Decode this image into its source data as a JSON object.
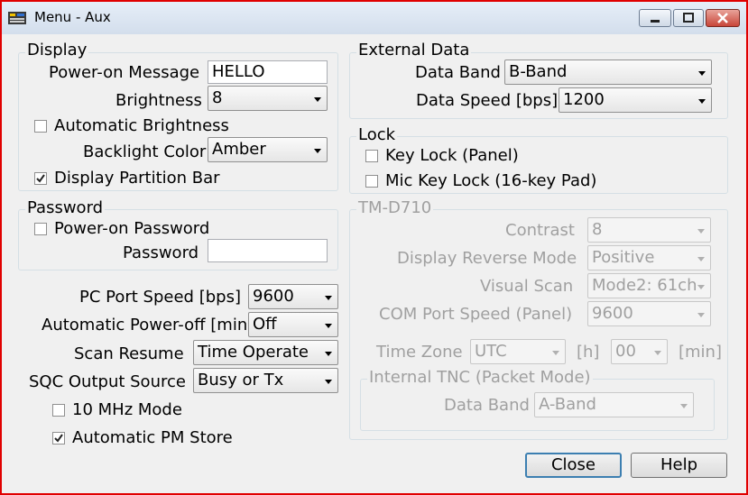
{
  "window": {
    "title": "Menu - Aux"
  },
  "display": {
    "legend": "Display",
    "power_on_message_label": "Power-on Message",
    "power_on_message_value": "HELLO",
    "brightness_label": "Brightness",
    "brightness_value": "8",
    "auto_brightness_label": "Automatic Brightness",
    "auto_brightness_checked": false,
    "backlight_color_label": "Backlight Color",
    "backlight_color_value": "Amber",
    "partition_bar_label": "Display Partition Bar",
    "partition_bar_checked": true
  },
  "password": {
    "legend": "Password",
    "power_on_password_label": "Power-on Password",
    "power_on_password_checked": false,
    "password_label": "Password",
    "password_value": ""
  },
  "misc": {
    "pc_port_speed_label": "PC Port Speed [bps]",
    "pc_port_speed_value": "9600",
    "auto_power_off_label": "Automatic Power-off [min]",
    "auto_power_off_value": "Off",
    "scan_resume_label": "Scan Resume",
    "scan_resume_value": "Time Operate",
    "sqc_output_label": "SQC Output Source",
    "sqc_output_value": "Busy or Tx",
    "mhz10_label": "10 MHz Mode",
    "mhz10_checked": false,
    "auto_pm_label": "Automatic PM Store",
    "auto_pm_checked": true
  },
  "external_data": {
    "legend": "External Data",
    "data_band_label": "Data Band",
    "data_band_value": "B-Band",
    "data_speed_label": "Data Speed [bps]",
    "data_speed_value": "1200"
  },
  "lock": {
    "legend": "Lock",
    "key_lock_label": "Key Lock (Panel)",
    "key_lock_checked": false,
    "mic_key_lock_label": "Mic Key Lock (16-key Pad)",
    "mic_key_lock_checked": false
  },
  "tmd710": {
    "legend": "TM-D710",
    "contrast_label": "Contrast",
    "contrast_value": "8",
    "reverse_mode_label": "Display Reverse Mode",
    "reverse_mode_value": "Positive",
    "visual_scan_label": "Visual Scan",
    "visual_scan_value": "Mode2: 61ch",
    "com_port_label": "COM Port Speed (Panel)",
    "com_port_value": "9600",
    "time_zone_label": "Time Zone",
    "time_zone_value": "UTC",
    "hour_unit": "[h]",
    "minute_value": "00",
    "minute_unit": "[min]",
    "tnc_legend": "Internal TNC (Packet Mode)",
    "tnc_data_band_label": "Data Band",
    "tnc_data_band_value": "A-Band"
  },
  "buttons": {
    "close": "Close",
    "help": "Help"
  },
  "icons": {
    "app": "app-icon",
    "minimize": "minimize-icon",
    "maximize": "maximize-icon",
    "close": "close-icon",
    "checkmark": "checkmark-icon",
    "dropdown": "chevron-down-icon"
  }
}
